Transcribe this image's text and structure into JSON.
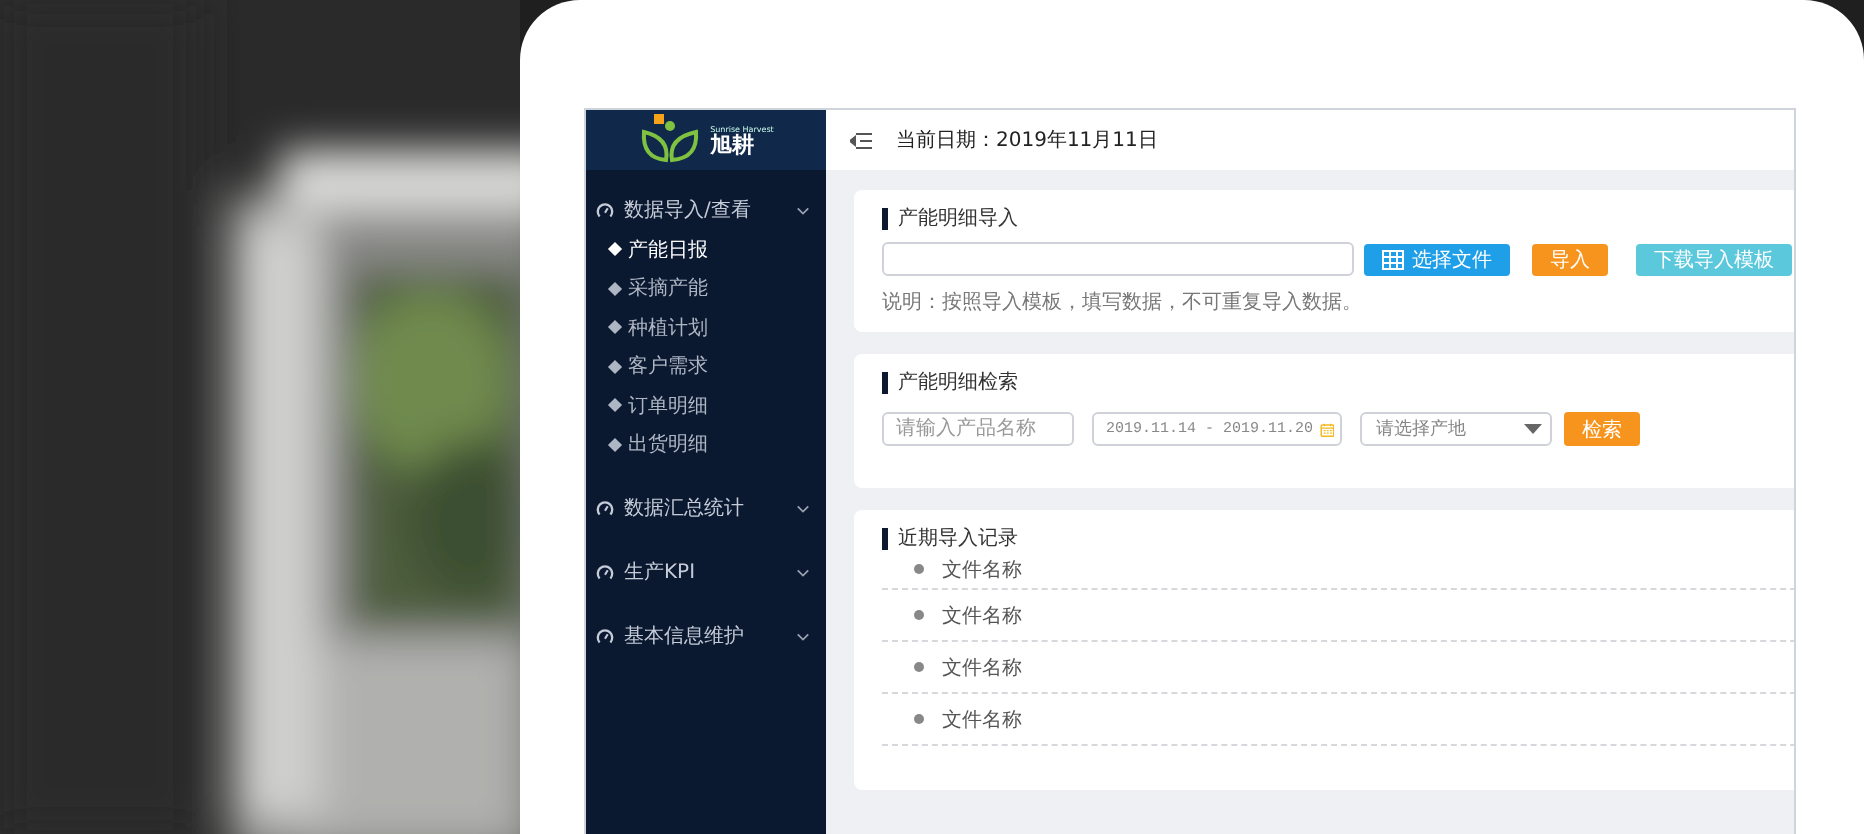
{
  "logo": {
    "tagline": "Sunrise Harvest",
    "name": "旭耕"
  },
  "header": {
    "date": "当前日期：2019年11月11日"
  },
  "sidebar": {
    "groups": [
      {
        "label": "数据导入/查看",
        "children": [
          {
            "label": "产能日报",
            "selected": true
          },
          {
            "label": "采摘产能",
            "selected": false
          },
          {
            "label": "种植计划",
            "selected": false
          },
          {
            "label": "客户需求",
            "selected": false
          },
          {
            "label": "订单明细",
            "selected": false
          },
          {
            "label": "出货明细",
            "selected": false
          }
        ]
      },
      {
        "label": "数据汇总统计"
      },
      {
        "label": "生产KPI"
      },
      {
        "label": "基本信息维护"
      }
    ]
  },
  "import_card": {
    "title": "产能明细导入",
    "buttons": [
      {
        "label": "选择文件",
        "kind": "choose"
      },
      {
        "label": "导入",
        "kind": "import"
      },
      {
        "label": "下载导入模板",
        "kind": "download"
      }
    ],
    "note": "说明：按照导入模板，填写数据，不可重复导入数据。"
  },
  "search_card": {
    "title": "产能明细检索",
    "product_field": {
      "placeholder": "请输入产品名称"
    },
    "date_range": {
      "value": "2019.11.14 - 2019.11.20"
    },
    "origin_select": {
      "placeholder": "请选择产地"
    },
    "search_button": "检索"
  },
  "records_card": {
    "title": "近期导入记录",
    "files": [
      "文件名称",
      "文件名称",
      "文件名称",
      "文件名称"
    ]
  }
}
